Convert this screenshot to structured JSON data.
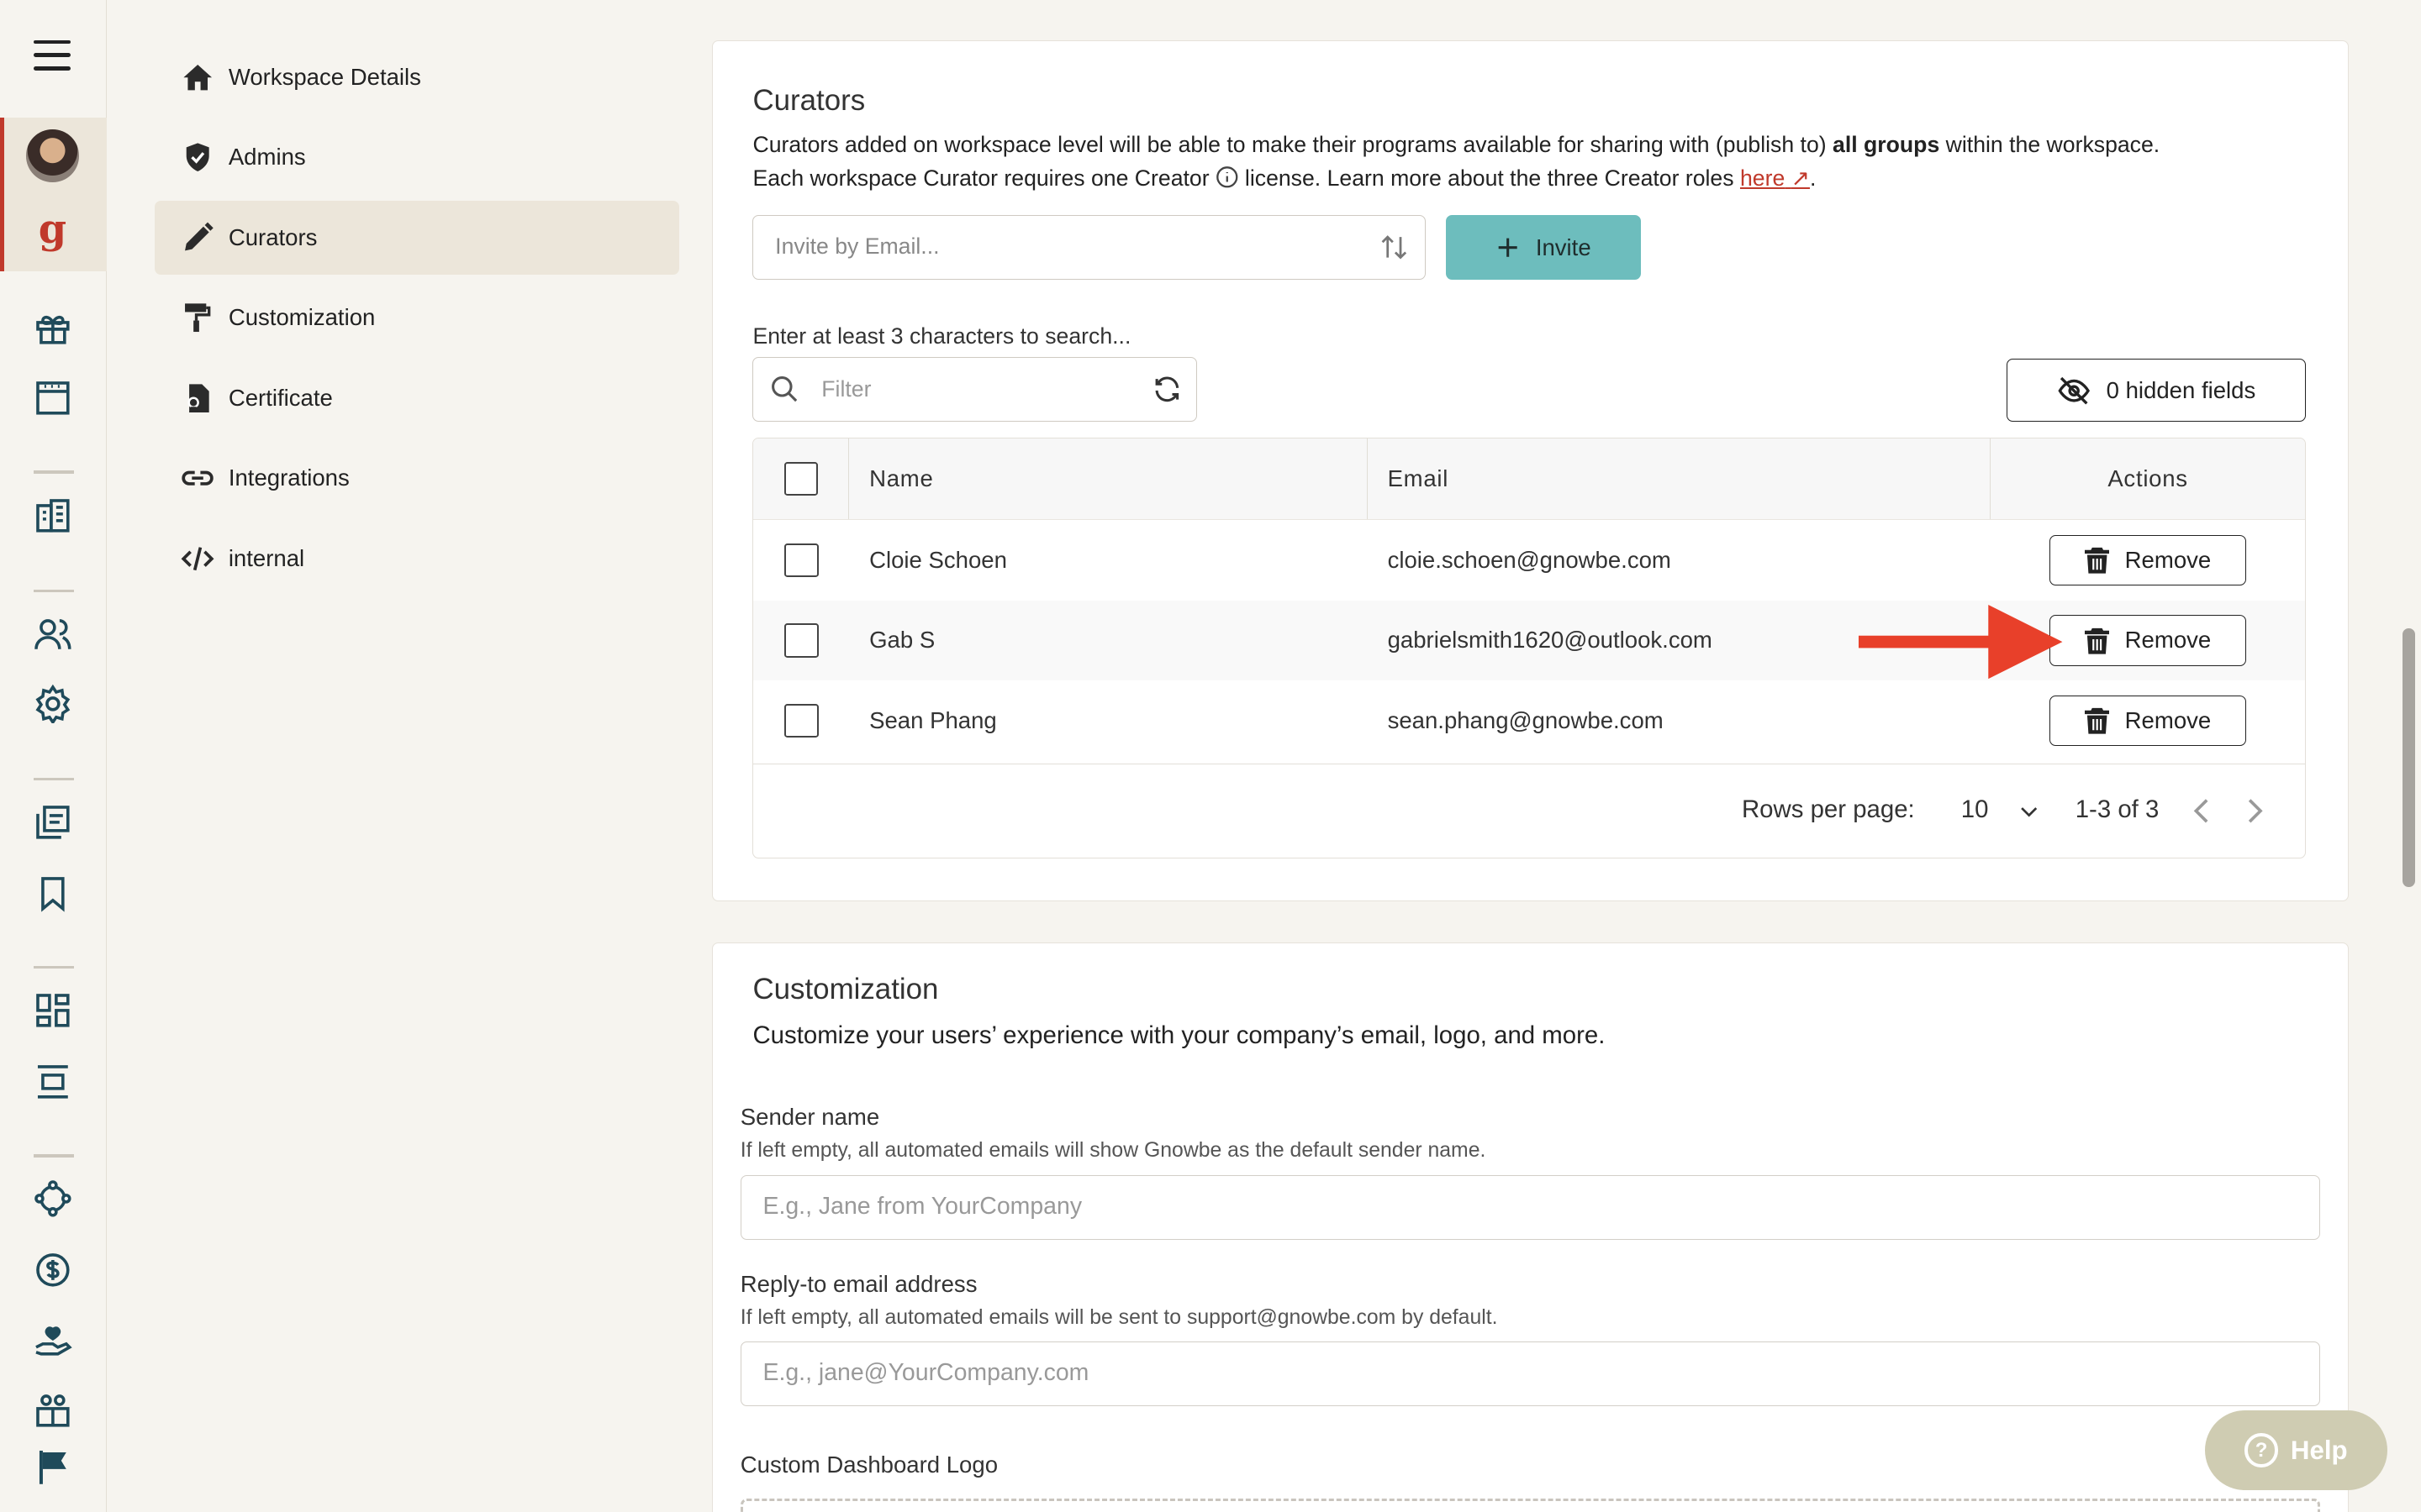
{
  "subnav": {
    "items": [
      {
        "label": "Workspace Details",
        "icon": "home-icon"
      },
      {
        "label": "Admins",
        "icon": "shield-check-icon"
      },
      {
        "label": "Curators",
        "icon": "pencil-icon",
        "active": true
      },
      {
        "label": "Customization",
        "icon": "paint-roller-icon"
      },
      {
        "label": "Certificate",
        "icon": "certificate-icon"
      },
      {
        "label": "Integrations",
        "icon": "link-icon"
      },
      {
        "label": "internal",
        "icon": "code-icon"
      }
    ]
  },
  "curators": {
    "title": "Curators",
    "desc_line1_pre": "Curators added on workspace level will be able to make their programs available for sharing with (publish to) ",
    "desc_line1_bold": "all groups",
    "desc_line1_post": " within the workspace.",
    "desc_line2_pre": "Each workspace Curator requires one Creator ",
    "desc_line2_post": " license. Learn more about the three Creator roles ",
    "desc_link": "here",
    "desc_end": ".",
    "invite_placeholder": "Invite by Email...",
    "invite_button": "Invite",
    "search_hint": "Enter at least 3 characters to search...",
    "filter_placeholder": "Filter",
    "hidden_fields_button": "0 hidden fields",
    "table": {
      "headers": {
        "name": "Name",
        "email": "Email",
        "actions": "Actions"
      },
      "rows": [
        {
          "name": "Cloie Schoen",
          "email": "cloie.schoen@gnowbe.com",
          "action": "Remove"
        },
        {
          "name": "Gab S",
          "email": "gabrielsmith1620@outlook.com",
          "action": "Remove"
        },
        {
          "name": "Sean Phang",
          "email": "sean.phang@gnowbe.com",
          "action": "Remove"
        }
      ]
    },
    "pagination": {
      "rows_per_page_label": "Rows per page:",
      "rows_per_page_value": "10",
      "range": "1-3 of 3"
    }
  },
  "customization": {
    "title": "Customization",
    "desc": "Customize your users’ experience with your company’s email, logo, and more.",
    "sender_name_label": "Sender name",
    "sender_name_help": "If left empty, all automated emails will show Gnowbe as the default sender name.",
    "sender_name_placeholder": "E.g., Jane from YourCompany",
    "reply_to_label": "Reply-to email address",
    "reply_to_help": "If left empty, all automated emails will be sent to support@gnowbe.com by default.",
    "reply_to_placeholder": "E.g., jane@YourCompany.com",
    "logo_label": "Custom Dashboard Logo"
  },
  "help_button": "Help",
  "colors": {
    "accent_teal": "#6dbdbd",
    "brand_red": "#c0392b",
    "annotation_arrow": "#e8402a",
    "background": "#f6f4ef"
  }
}
